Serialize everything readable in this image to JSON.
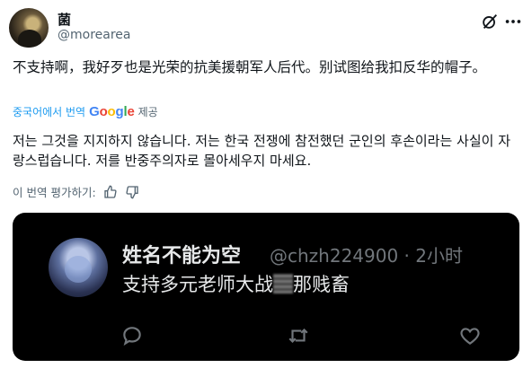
{
  "post": {
    "author_name": "菌",
    "author_handle": "@morearea",
    "original_text": "不支持啊，我好歹也是光荣的抗美援朝军人后代。别试图给我扣反华的帽子。",
    "translated_from": "중국어에서 번역",
    "google_letters": [
      "G",
      "o",
      "o",
      "g",
      "l",
      "e"
    ],
    "provided_label": "제공",
    "translated_text": "저는 그것을 지지하지 않습니다. 저는 한국 전쟁에 참전했던 군인의 후손이라는 사실이 자랑스럽습니다. 저를 반중주의자로 몰아세우지 마세요.",
    "rate_label": "이 번역 평가하기:"
  },
  "embedded": {
    "name": "姓名不能为空",
    "meta": "@chzh224900 · 2小时",
    "text_before": "支持多元老师大战",
    "text_after": "那贱畜"
  },
  "icons": [
    "grok-icon",
    "more-icon",
    "thumbs-up-icon",
    "thumbs-down-icon",
    "reply-icon",
    "retweet-icon",
    "heart-icon"
  ],
  "colors": {
    "link": "#1d9bf0",
    "secondary": "#536471",
    "media_bg": "#000000"
  }
}
